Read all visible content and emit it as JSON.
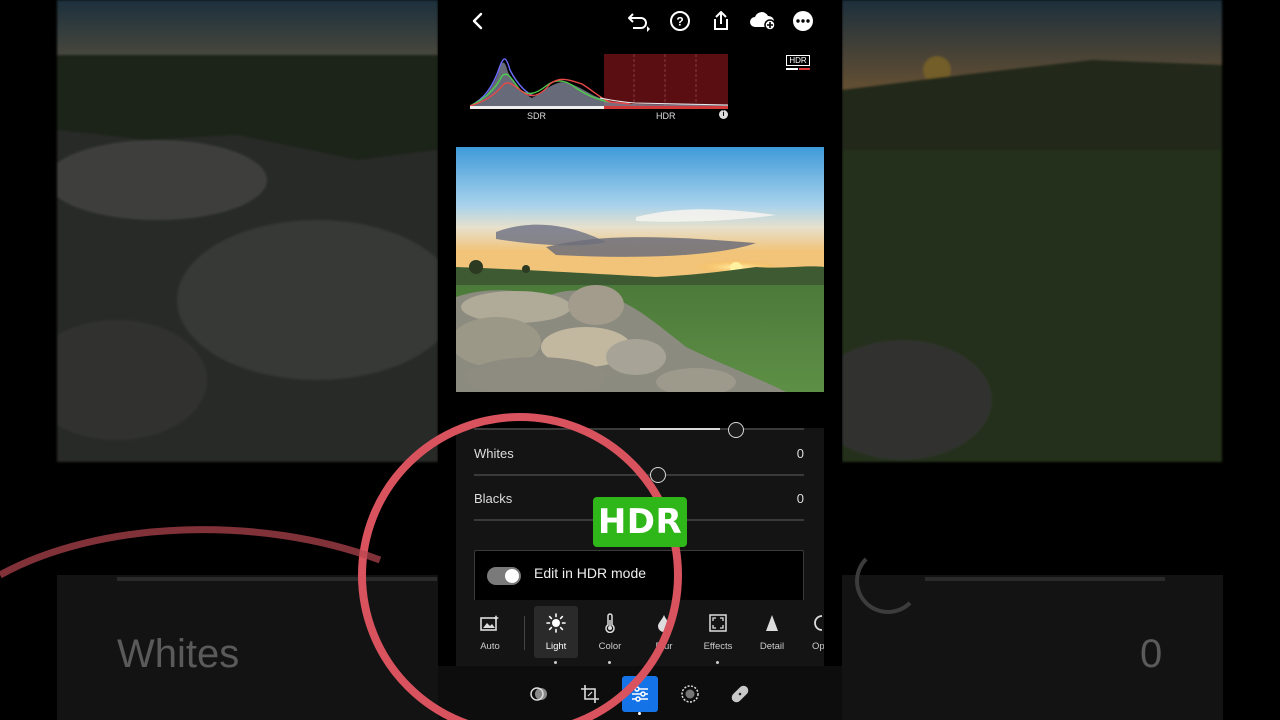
{
  "background": {
    "whites_label": "Whites",
    "whites_value": "0"
  },
  "topbar": {
    "icons": [
      "back-icon",
      "undo-icon",
      "help-icon",
      "share-icon",
      "cloud-add-icon",
      "more-icon"
    ]
  },
  "histogram": {
    "sdr_label": "SDR",
    "hdr_label": "HDR",
    "hdr_badge": "HDR"
  },
  "sliders": [
    {
      "label": "Whites",
      "value": "0"
    },
    {
      "label": "Blacks",
      "value": "0"
    }
  ],
  "hdr_toggle": {
    "label": "Edit in HDR mode",
    "enabled": true
  },
  "tools": [
    {
      "label": "Auto",
      "icon": "auto-image-icon"
    },
    {
      "label": "Light",
      "icon": "sun-icon",
      "active": true
    },
    {
      "label": "Color",
      "icon": "thermometer-icon"
    },
    {
      "label": "Blur",
      "icon": "drop-icon"
    },
    {
      "label": "Effects",
      "icon": "effects-frame-icon"
    },
    {
      "label": "Detail",
      "icon": "triangle-icon"
    },
    {
      "label": "Op",
      "icon": "optics-icon"
    }
  ],
  "bottom_tools": [
    "presets-icon",
    "crop-icon",
    "edit-sliders-icon",
    "masking-icon",
    "healing-icon"
  ],
  "sticker": "HDR",
  "colors": {
    "accent": "#1473e6",
    "sticker": "#2fb618",
    "circle": "#d9535f"
  }
}
